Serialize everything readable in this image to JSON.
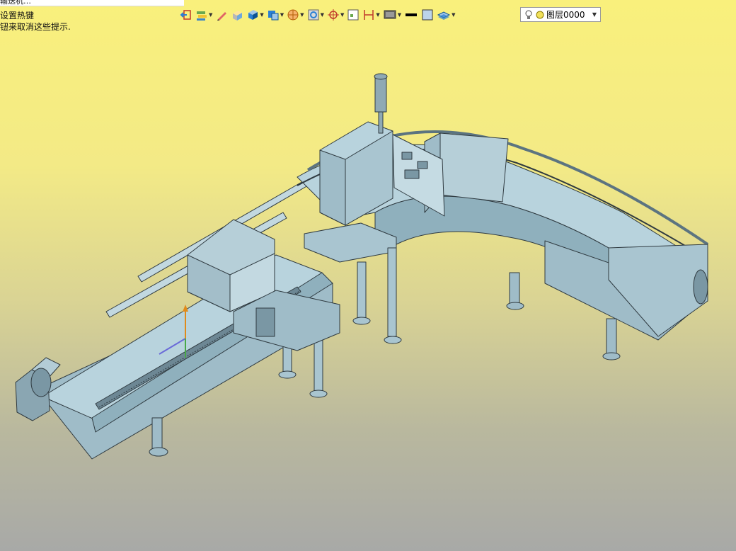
{
  "window": {
    "title": "输送机…"
  },
  "hints": [
    "设置热键",
    "钮来取消这些提示."
  ],
  "toolbar": {
    "buttons": [
      {
        "name": "exit-sketch-icon",
        "has_menu": false
      },
      {
        "name": "layer-stack-icon",
        "has_menu": true
      },
      {
        "name": "pencil-icon",
        "has_menu": false
      },
      {
        "name": "box-paint-icon",
        "has_menu": false
      },
      {
        "name": "solid-cube-icon",
        "has_menu": true
      },
      {
        "name": "view-cube-icon",
        "has_menu": true
      },
      {
        "name": "sphere-render-icon",
        "has_menu": true
      },
      {
        "name": "zoom-fit-icon",
        "has_menu": true
      },
      {
        "name": "move-crosshair-icon",
        "has_menu": true
      },
      {
        "name": "grid-view-icon",
        "has_menu": false
      },
      {
        "name": "dimension-icon",
        "has_menu": true
      },
      {
        "name": "monitor-icon",
        "has_menu": true
      },
      {
        "name": "line-weight-icon",
        "has_menu": false
      },
      {
        "name": "fill-color-icon",
        "has_menu": false
      },
      {
        "name": "layers-icon",
        "has_menu": true
      }
    ],
    "layer_select": {
      "value": "图层0000"
    }
  },
  "colors": {
    "accent_blue": "#2a7fd4",
    "bg_top": "#f9f07c",
    "bg_bottom": "#a8a9a7",
    "model_fill": "#a9c5d0",
    "model_edge": "#2f3a40"
  }
}
